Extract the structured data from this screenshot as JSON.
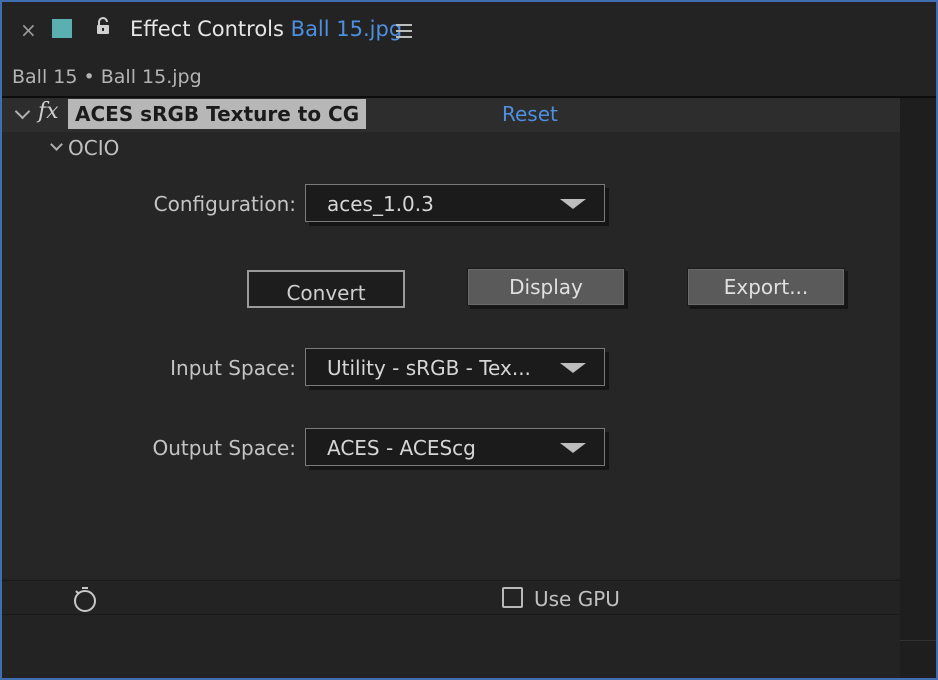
{
  "header": {
    "close_glyph": "×",
    "title": "Effect Controls",
    "file": "Ball 15.jpg"
  },
  "subtitle": "Ball 15 • Ball 15.jpg",
  "effect": {
    "name": "ACES sRGB Texture to CG",
    "fx_glyph": "fx",
    "reset_label": "Reset",
    "group_label": "OCIO"
  },
  "fields": {
    "configuration": {
      "label": "Configuration:",
      "value": "aces_1.0.3"
    },
    "input_space": {
      "label": "Input Space:",
      "value": "Utility - sRGB - Tex..."
    },
    "output_space": {
      "label": "Output Space:",
      "value": "ACES - ACEScg"
    }
  },
  "buttons": {
    "convert": "Convert",
    "display": "Display",
    "export": "Export..."
  },
  "footer": {
    "use_gpu_label": "Use GPU",
    "use_gpu_checked": false
  },
  "colors": {
    "accent_link": "#4f8fe0",
    "swatch": "#5ab0b0",
    "frame_border": "#3f6fb0"
  }
}
